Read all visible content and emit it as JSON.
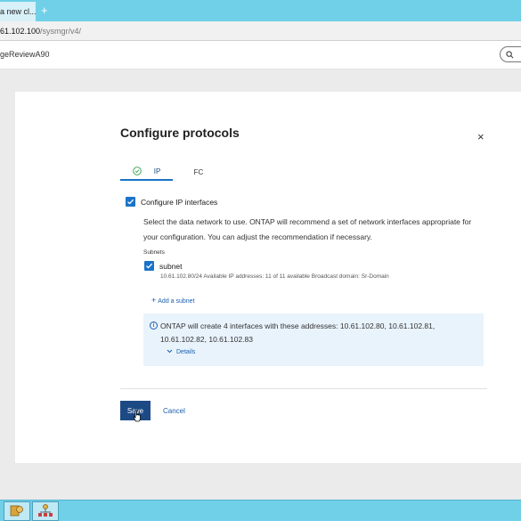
{
  "browser": {
    "tab_label": "a new cl...",
    "tab_close": "×",
    "new_tab": "+",
    "url_host": "61.102.100",
    "url_path": "/sysmgr/v4/"
  },
  "app": {
    "title": "geReviewA90",
    "search_glyph": "Q"
  },
  "modal": {
    "title": "Configure protocols",
    "close": "×",
    "tabs": [
      {
        "label": "IP",
        "active": true
      },
      {
        "label": "FC",
        "active": false
      }
    ],
    "configure_ip_label": "Configure IP interfaces",
    "configure_ip_checked": true,
    "description": "Select the data network to use. ONTAP will recommend a set of network interfaces appropriate for your configuration. You can adjust the recommendation if necessary.",
    "subnets_label": "Subnets",
    "subnet": {
      "name": "subnet",
      "checked": true,
      "details": "10.61.102.80/24  Available IP addresses: 11 of 11 available  Broadcast domain: Sr-Domain"
    },
    "add_subnet": "Add a subnet",
    "info_text": "ONTAP will create 4 interfaces with these addresses: 10.61.102.80, 10.61.102.81, 10.61.102.82, 10.61.102.83",
    "details_link": "Details",
    "save_label": "Save",
    "cancel_label": "Cancel"
  },
  "colors": {
    "accent": "#1a73c8",
    "primary_button": "#1d4a85",
    "info_bg": "#e9f3fc",
    "chrome": "#6fd0e8"
  }
}
